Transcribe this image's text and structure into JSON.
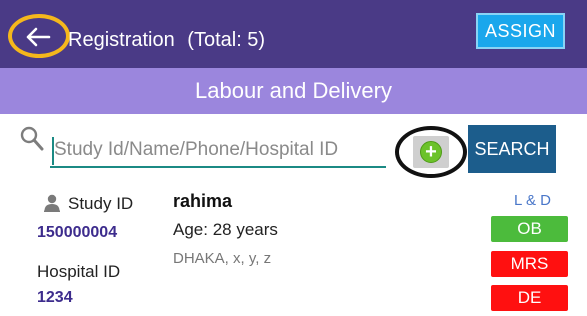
{
  "header": {
    "title": "Registration",
    "total": "(Total: 5)",
    "assign_label": "ASSIGN"
  },
  "subheader": {
    "title": "Labour and Delivery"
  },
  "search": {
    "placeholder": "Study Id/Name/Phone/Hospital ID",
    "value": "",
    "button_label": "SEARCH"
  },
  "record": {
    "study_id_label": "Study ID",
    "study_id": "150000004",
    "hospital_id_label": "Hospital ID",
    "hospital_id": "1234",
    "name": "rahima",
    "age": "Age: 28 years",
    "location": "DHAKA, x, y, z",
    "section": "L & D",
    "badges": [
      {
        "label": "OB",
        "color": "#4cbb3c"
      },
      {
        "label": "MRS",
        "color": "#ff1010"
      },
      {
        "label": "DE",
        "color": "#ff1010"
      }
    ]
  },
  "icons": [
    "back-arrow-icon",
    "search-icon",
    "add-icon",
    "person-icon"
  ],
  "colors": {
    "topbar": "#4a3a86",
    "subheader": "#9b86dd",
    "assign": "#1aa7ec",
    "search_button": "#1c5d8c",
    "accent_underline": "#1b8a84",
    "id_value": "#3d2c8d"
  }
}
